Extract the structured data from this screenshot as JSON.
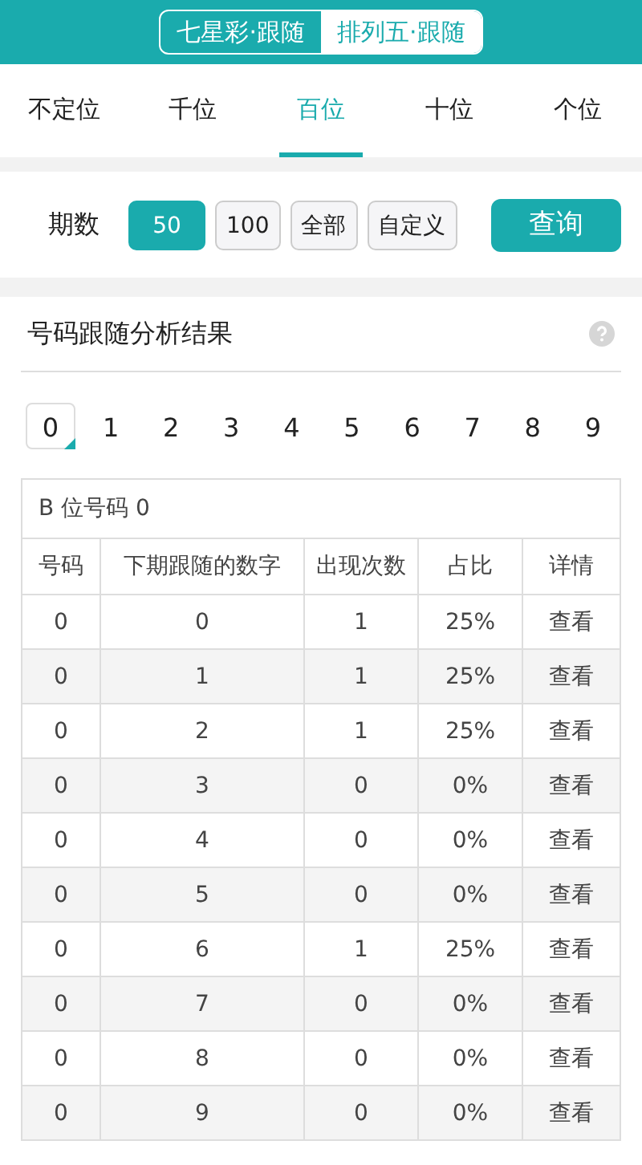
{
  "header": {
    "segments": [
      {
        "label": "七星彩·跟随",
        "selected": true
      },
      {
        "label": "排列五·跟随",
        "selected": false
      }
    ]
  },
  "position_tabs": [
    {
      "label": "不定位",
      "selected": false
    },
    {
      "label": "千位",
      "selected": false
    },
    {
      "label": "百位",
      "selected": true
    },
    {
      "label": "十位",
      "selected": false
    },
    {
      "label": "个位",
      "selected": false
    }
  ],
  "filter": {
    "label": "期数",
    "options": [
      {
        "label": "50",
        "selected": true
      },
      {
        "label": "100",
        "selected": false
      },
      {
        "label": "全部",
        "selected": false
      },
      {
        "label": "自定义",
        "selected": false
      }
    ],
    "query_button": "查询"
  },
  "result": {
    "title": "号码跟随分析结果",
    "digits": [
      {
        "label": "0",
        "selected": true
      },
      {
        "label": "1",
        "selected": false
      },
      {
        "label": "2",
        "selected": false
      },
      {
        "label": "3",
        "selected": false
      },
      {
        "label": "4",
        "selected": false
      },
      {
        "label": "5",
        "selected": false
      },
      {
        "label": "6",
        "selected": false
      },
      {
        "label": "7",
        "selected": false
      },
      {
        "label": "8",
        "selected": false
      },
      {
        "label": "9",
        "selected": false
      }
    ],
    "table": {
      "caption": "B 位号码 0",
      "columns": [
        "号码",
        "下期跟随的数字",
        "出现次数",
        "占比",
        "详情"
      ],
      "rows": [
        [
          "0",
          "0",
          "1",
          "25%",
          "查看"
        ],
        [
          "0",
          "1",
          "1",
          "25%",
          "查看"
        ],
        [
          "0",
          "2",
          "1",
          "25%",
          "查看"
        ],
        [
          "0",
          "3",
          "0",
          "0%",
          "查看"
        ],
        [
          "0",
          "4",
          "0",
          "0%",
          "查看"
        ],
        [
          "0",
          "5",
          "0",
          "0%",
          "查看"
        ],
        [
          "0",
          "6",
          "1",
          "25%",
          "查看"
        ],
        [
          "0",
          "7",
          "0",
          "0%",
          "查看"
        ],
        [
          "0",
          "8",
          "0",
          "0%",
          "查看"
        ],
        [
          "0",
          "9",
          "0",
          "0%",
          "查看"
        ]
      ]
    }
  }
}
